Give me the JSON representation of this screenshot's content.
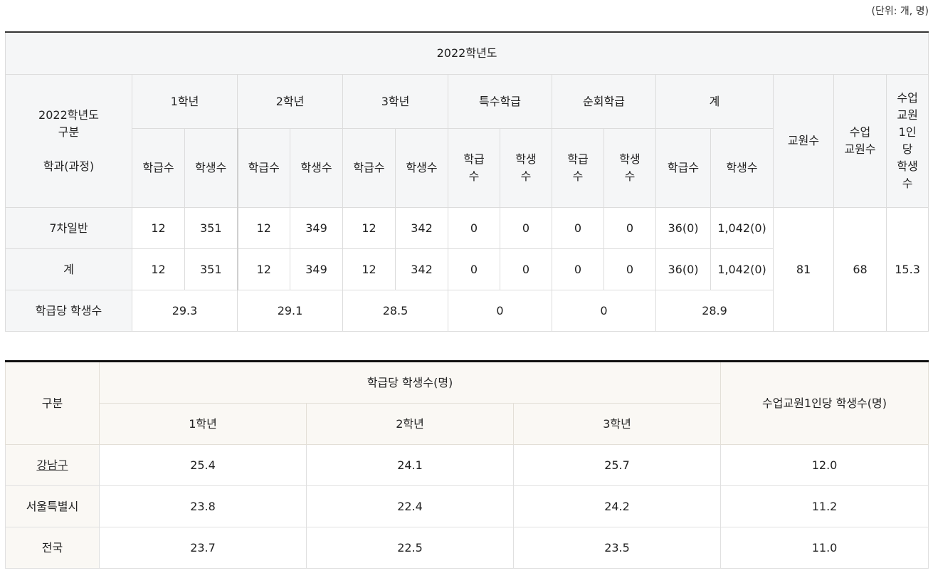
{
  "unit_note": "(단위: 개, 명)",
  "table1": {
    "year_header": "2022학년도",
    "corner": {
      "line1": "2022학년도",
      "line2": "구분",
      "line3": "학과(과정)"
    },
    "groups": [
      "1학년",
      "2학년",
      "3학년",
      "특수학급",
      "순회학급",
      "계"
    ],
    "teachers_header": "교원수",
    "class_teachers_header": "수업\n교원수",
    "per_teacher_header": "수업\n교원\n1인\n당\n학생\n수",
    "sub_headers": [
      "학급수",
      "학생수",
      "학급수",
      "학생수",
      "학급수",
      "학생수",
      "학급\n수",
      "학생\n수",
      "학급\n수",
      "학생\n수",
      "학급수",
      "학생수"
    ],
    "rows": [
      {
        "label": "7차일반",
        "cells": [
          "12",
          "351",
          "12",
          "349",
          "12",
          "342",
          "0",
          "0",
          "0",
          "0",
          "36(0)",
          "1,042(0)"
        ]
      },
      {
        "label": "계",
        "cells": [
          "12",
          "351",
          "12",
          "349",
          "12",
          "342",
          "0",
          "0",
          "0",
          "0",
          "36(0)",
          "1,042(0)"
        ]
      }
    ],
    "teachers_value": "81",
    "class_teachers_value": "68",
    "per_teacher_value": "15.3",
    "per_class_row": {
      "label": "학급당 학생수",
      "values": [
        "29.3",
        "29.1",
        "28.5",
        "0",
        "0",
        "28.9"
      ]
    }
  },
  "table2": {
    "category_header": "구분",
    "per_class_header": "학급당 학생수(명)",
    "grades": [
      "1학년",
      "2학년",
      "3학년"
    ],
    "per_teacher_header": "수업교원1인당 학생수(명)",
    "rows": [
      {
        "label": "강남구",
        "g1": "25.4",
        "g2": "24.1",
        "g3": "25.7",
        "per_teacher": "12.0"
      },
      {
        "label": "서울특별시",
        "g1": "23.8",
        "g2": "22.4",
        "g3": "24.2",
        "per_teacher": "11.2"
      },
      {
        "label": "전국",
        "g1": "23.7",
        "g2": "22.5",
        "g3": "23.5",
        "per_teacher": "11.0"
      }
    ]
  }
}
